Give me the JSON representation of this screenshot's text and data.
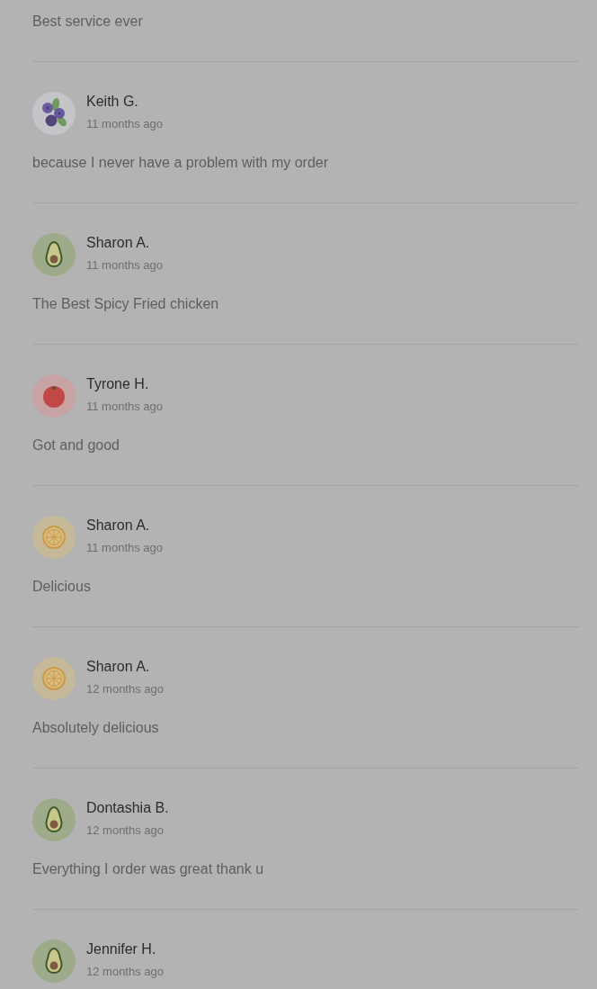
{
  "reviews": [
    {
      "comment": "Best service ever"
    },
    {
      "avatar": {
        "kind": "blueberry"
      },
      "name": "Keith G.",
      "time": "11 months ago",
      "comment": "because I never have a problem with my order"
    },
    {
      "avatar": {
        "kind": "avocado"
      },
      "name": "Sharon A.",
      "time": "11 months ago",
      "comment": "The Best Spicy Fried chicken"
    },
    {
      "avatar": {
        "kind": "tomato"
      },
      "name": "Tyrone H.",
      "time": "11 months ago",
      "comment": "Got and good"
    },
    {
      "avatar": {
        "kind": "citrus"
      },
      "name": "Sharon A.",
      "time": "11 months ago",
      "comment": "Delicious"
    },
    {
      "avatar": {
        "kind": "citrus"
      },
      "name": "Sharon A.",
      "time": "12 months ago",
      "comment": "Absolutely delicious"
    },
    {
      "avatar": {
        "kind": "avocado"
      },
      "name": "Dontashia B.",
      "time": "12 months ago",
      "comment": "Everything I order was great thank u"
    },
    {
      "avatar": {
        "kind": "avocado"
      },
      "name": "Jennifer H.",
      "time": "12 months ago"
    }
  ]
}
